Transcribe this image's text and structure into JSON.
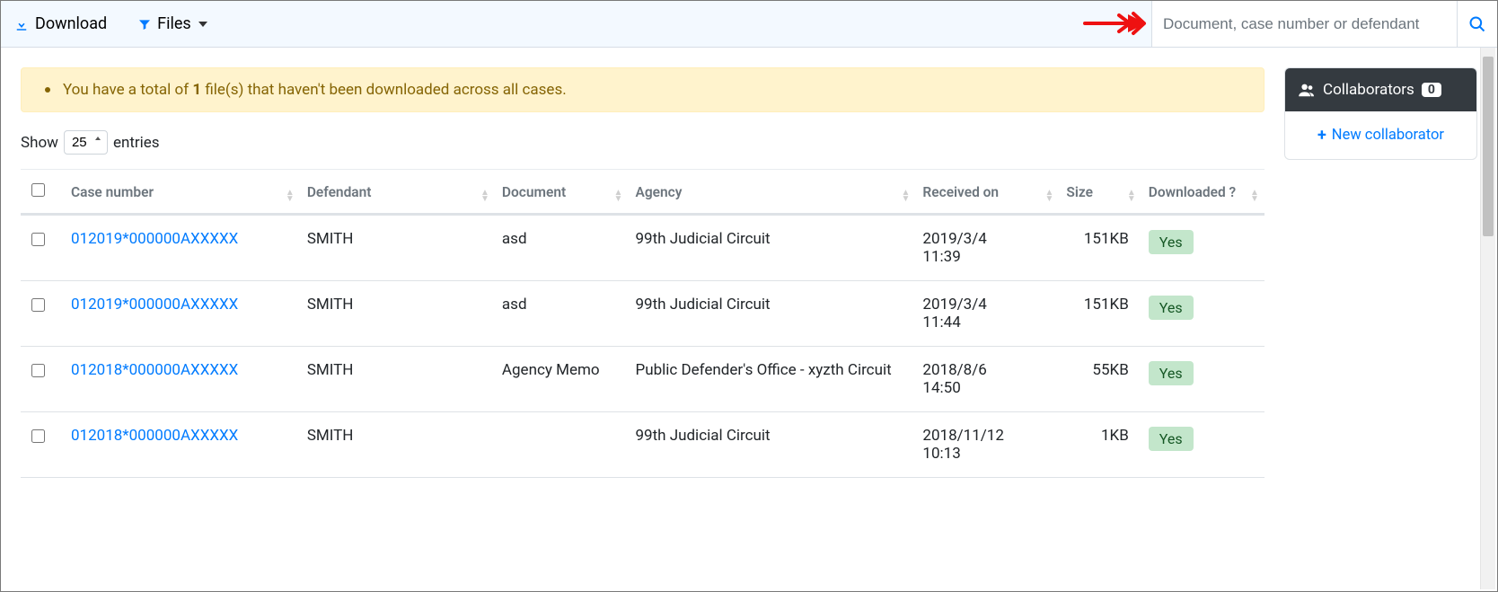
{
  "topbar": {
    "download_label": "Download",
    "files_label": "Files"
  },
  "search": {
    "placeholder": "Document, case number or defendant"
  },
  "alert": {
    "prefix": "You have a total of ",
    "count": "1",
    "suffix": " file(s) that haven't been downloaded across all cases."
  },
  "entries": {
    "show_label": "Show",
    "entries_label": "entries",
    "selected": "25"
  },
  "columns": {
    "case_number": "Case number",
    "defendant": "Defendant",
    "document": "Document",
    "agency": "Agency",
    "received_on": "Received on",
    "size": "Size",
    "downloaded": "Downloaded ?"
  },
  "rows": [
    {
      "case": "012019*000000AXXXXX",
      "defendant": "SMITH",
      "document": "asd",
      "agency": "99th Judicial Circuit",
      "received": "2019/3/4 11:39",
      "size": "151KB",
      "downloaded": "Yes"
    },
    {
      "case": "012019*000000AXXXXX",
      "defendant": "SMITH",
      "document": "asd",
      "agency": "99th Judicial Circuit",
      "received": "2019/3/4 11:44",
      "size": "151KB",
      "downloaded": "Yes"
    },
    {
      "case": "012018*000000AXXXXX",
      "defendant": "SMITH",
      "document": "Agency Memo",
      "agency": "Public Defender's Office - xyzth Circuit",
      "received": "2018/8/6 14:50",
      "size": "55KB",
      "downloaded": "Yes"
    },
    {
      "case": "012018*000000AXXXXX",
      "defendant": "SMITH",
      "document": "",
      "agency": "99th Judicial Circuit",
      "received": "2018/11/12 10:13",
      "size": "1KB",
      "downloaded": "Yes"
    }
  ],
  "sidebar": {
    "collaborators_label": "Collaborators",
    "collaborators_count": "0",
    "new_collaborator_label": "New collaborator"
  }
}
